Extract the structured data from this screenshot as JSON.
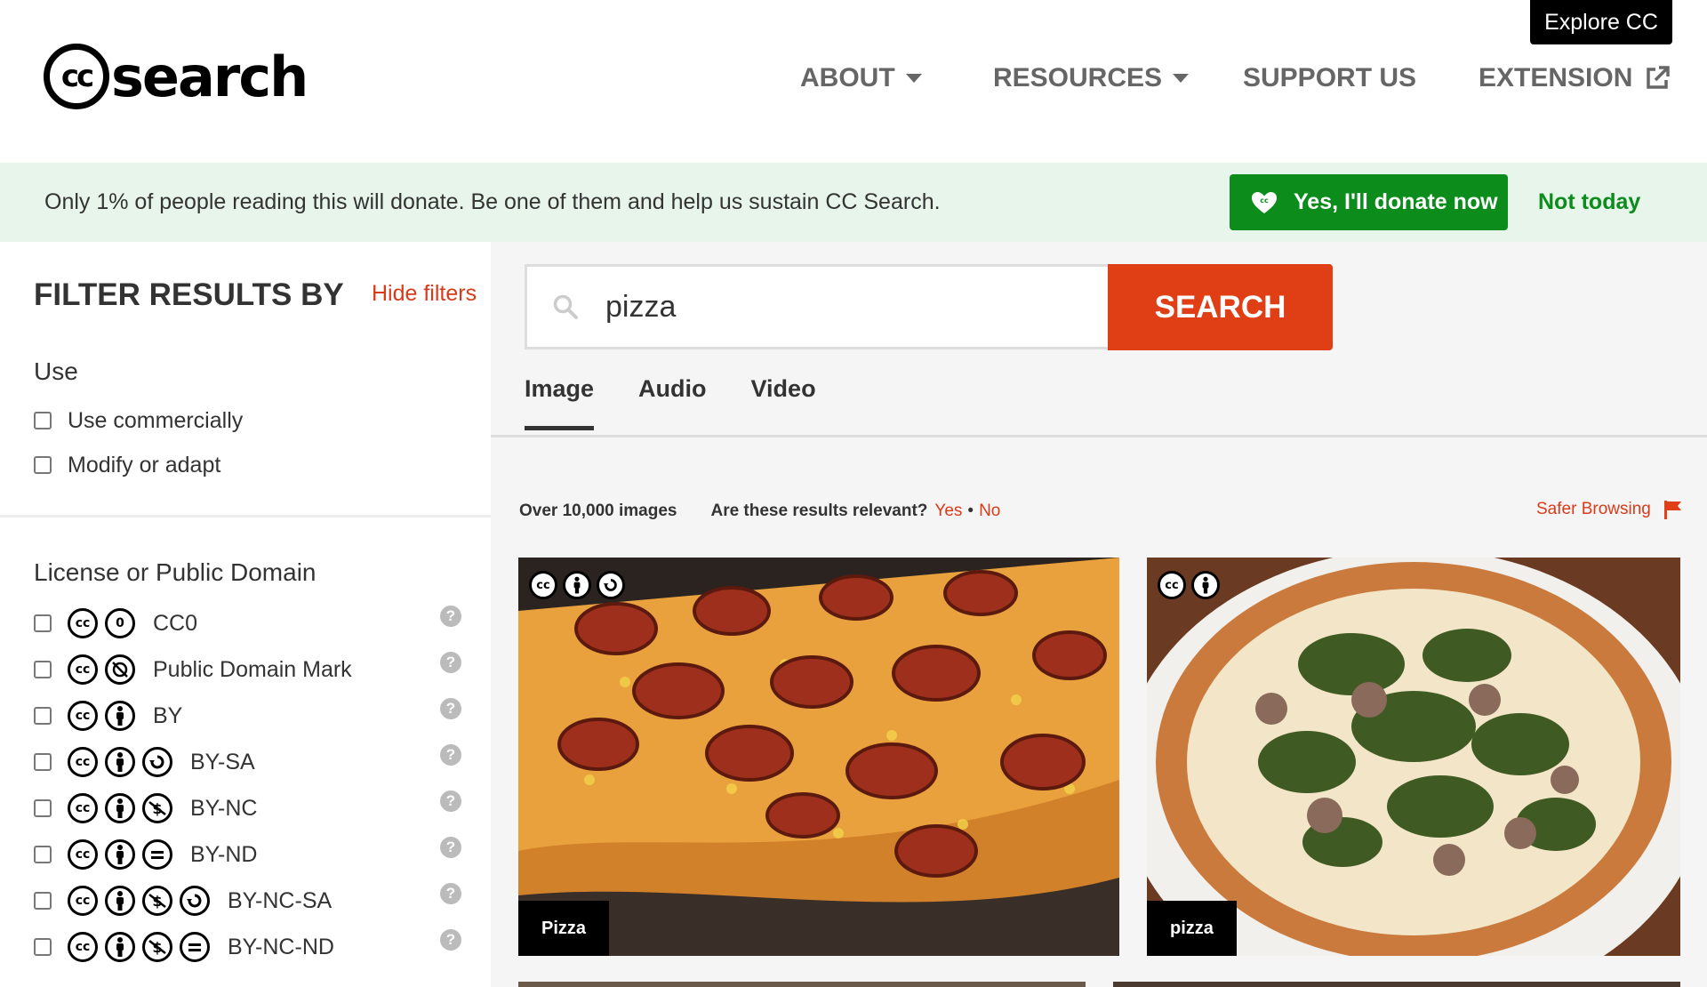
{
  "header": {
    "logo_cc": "cc",
    "logo_text": "search",
    "explore_label": "Explore CC",
    "nav": [
      {
        "label": "ABOUT",
        "icon": "caret-down-icon"
      },
      {
        "label": "RESOURCES",
        "icon": "caret-down-icon"
      },
      {
        "label": "SUPPORT US"
      },
      {
        "label": "EXTENSION",
        "icon": "external-link-icon"
      }
    ]
  },
  "donate": {
    "message": "Only 1% of people reading this will donate. Be one of them and help us sustain CC Search.",
    "yes_label": "Yes, I'll donate now",
    "no_label": "Not today",
    "bg_color": "#e8f5ea",
    "button_color": "#0b8c1b"
  },
  "filters": {
    "title": "FILTER RESULTS BY",
    "hide_label": "Hide filters",
    "use": {
      "title": "Use",
      "options": [
        "Use commercially",
        "Modify or adapt"
      ]
    },
    "license": {
      "title": "License or Public Domain",
      "options": [
        {
          "label": "CC0",
          "icons": [
            "cc-icon",
            "zero-icon"
          ]
        },
        {
          "label": "Public Domain Mark",
          "icons": [
            "cc-icon",
            "pd-icon"
          ]
        },
        {
          "label": "BY",
          "icons": [
            "cc-icon",
            "by-icon"
          ]
        },
        {
          "label": "BY-SA",
          "icons": [
            "cc-icon",
            "by-icon",
            "sa-icon"
          ]
        },
        {
          "label": "BY-NC",
          "icons": [
            "cc-icon",
            "by-icon",
            "nc-icon"
          ]
        },
        {
          "label": "BY-ND",
          "icons": [
            "cc-icon",
            "by-icon",
            "nd-icon"
          ]
        },
        {
          "label": "BY-NC-SA",
          "icons": [
            "cc-icon",
            "by-icon",
            "nc-icon",
            "sa-icon"
          ]
        },
        {
          "label": "BY-NC-ND",
          "icons": [
            "cc-icon",
            "by-icon",
            "nc-icon",
            "nd-icon"
          ]
        }
      ],
      "help_glyph": "?"
    }
  },
  "search": {
    "query": "pizza",
    "button_label": "SEARCH",
    "accent": "#e03e14"
  },
  "tabs": [
    "Image",
    "Audio",
    "Video"
  ],
  "results": {
    "count_text": "Over 10,000 images",
    "relevance_question": "Are these results relevant?",
    "yes": "Yes",
    "dot": "•",
    "no": "No",
    "safer_browsing": "Safer Browsing",
    "cards": [
      {
        "caption": "Pizza",
        "license_icons": [
          "cc-icon",
          "by-icon",
          "sa-icon"
        ]
      },
      {
        "caption": "pizza",
        "license_icons": [
          "cc-icon",
          "by-icon"
        ]
      }
    ]
  }
}
